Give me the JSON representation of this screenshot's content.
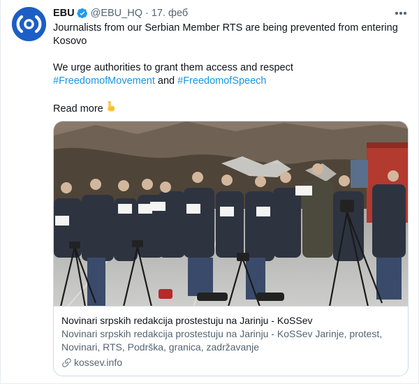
{
  "author": {
    "name": "EBU",
    "handle": "@EBU_HQ",
    "separator": "·",
    "date": "17. феб"
  },
  "tweet": {
    "line1": "Journalists from our Serbian Member RTS are being prevented from entering Kosovo",
    "line2_text": "We urge authorities to grant them access and respect",
    "hashtag1": "#FreedomofMovement",
    "conjunction": "and",
    "hashtag2": "#FreedomofSpeech",
    "read_more": "Read more"
  },
  "card": {
    "title": "Novinari srpskih redakcija prostestuju na Jarinju - KoSSev",
    "description": "Novinari srpskih redakcija prostestuju na Jarinju - KoSSev Jarinje, protest, Novinari, RTS, Podrška, granica, zadržavanje",
    "domain": "kossev.info"
  },
  "colors": {
    "brand_blue": "#1d5ec4",
    "verified_blue": "#1d9bf0",
    "link_blue": "#1b95e0",
    "secondary_text": "#536471",
    "border": "#cfd9de"
  },
  "icons": [
    "ebu-logo-icon",
    "verified-badge-icon",
    "more-options-icon",
    "pointing-down-emoji-icon",
    "link-icon"
  ]
}
